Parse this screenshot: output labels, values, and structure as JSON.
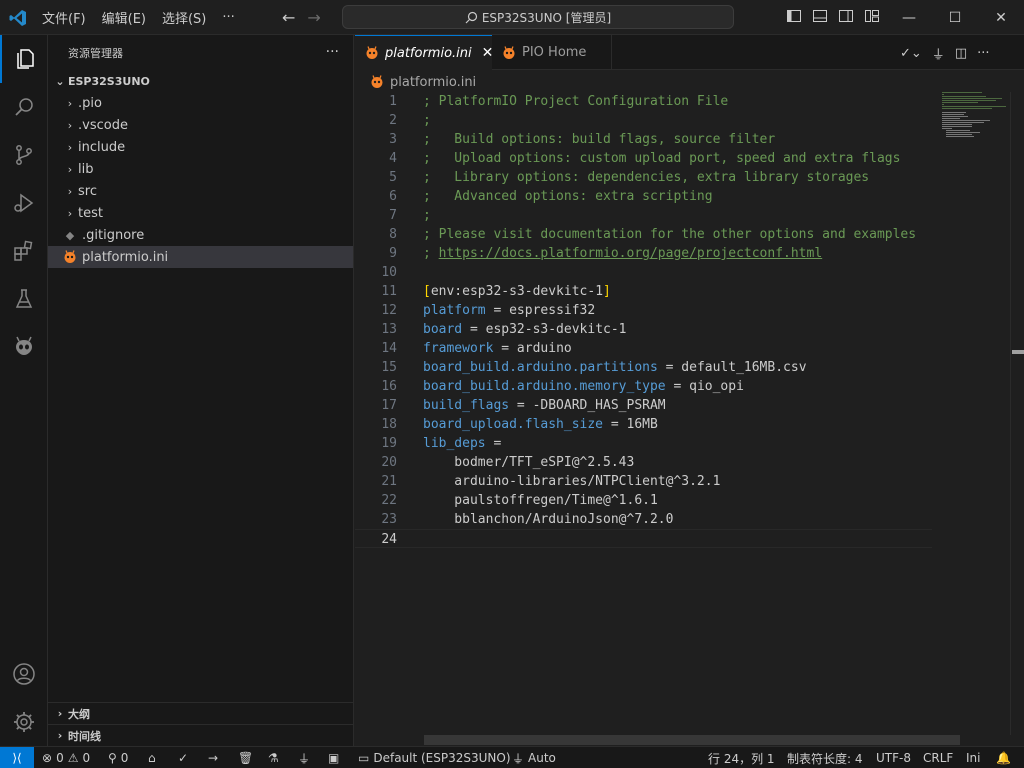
{
  "titlebar": {
    "menus": [
      "文件(F)",
      "编辑(E)",
      "选择(S)",
      "···"
    ],
    "search_text": "ESP32S3UNO [管理员]",
    "window_controls": [
      "minimize",
      "maximize",
      "close"
    ]
  },
  "sidebar": {
    "title": "资源管理器",
    "more": "···",
    "root": "ESP32S3UNO",
    "items": [
      {
        "label": ".pio",
        "type": "folder"
      },
      {
        "label": ".vscode",
        "type": "folder"
      },
      {
        "label": "include",
        "type": "folder"
      },
      {
        "label": "lib",
        "type": "folder"
      },
      {
        "label": "src",
        "type": "folder"
      },
      {
        "label": "test",
        "type": "folder"
      },
      {
        "label": ".gitignore",
        "type": "file"
      },
      {
        "label": "platformio.ini",
        "type": "file",
        "selected": true
      }
    ],
    "outline": "大纲",
    "timeline": "时间线"
  },
  "tabs": [
    {
      "label": "platformio.ini",
      "active": true
    },
    {
      "label": "PIO Home",
      "active": false
    }
  ],
  "breadcrumb": "platformio.ini",
  "editor": {
    "current_line": 24,
    "lines": [
      "; PlatformIO Project Configuration File",
      ";",
      ";   Build options: build flags, source filter",
      ";   Upload options: custom upload port, speed and extra flags",
      ";   Library options: dependencies, extra library storages",
      ";   Advanced options: extra scripting",
      ";",
      "; Please visit documentation for the other options and examples",
      "; https://docs.platformio.org/page/projectconf.html",
      "",
      "[env:esp32-s3-devkitc-1]",
      "platform = espressif32",
      "board = esp32-s3-devkitc-1",
      "framework = arduino",
      "board_build.arduino.partitions = default_16MB.csv",
      "board_build.arduino.memory_type = qio_opi",
      "build_flags = -DBOARD_HAS_PSRAM",
      "board_upload.flash_size = 16MB",
      "lib_deps =",
      "    bodmer/TFT_eSPI@^2.5.43",
      "    arduino-libraries/NTPClient@^3.2.1",
      "    paulstoffregen/Time@^1.6.1",
      "    bblanchon/ArduinoJson@^7.2.0",
      ""
    ]
  },
  "statusbar": {
    "problems_errors": "0",
    "problems_warnings": "0",
    "ports": "0",
    "env": "Default (ESP32S3UNO)",
    "auto": "Auto",
    "cursor": "行 24，列 1",
    "indent": "制表符长度: 4",
    "encoding": "UTF-8",
    "eol": "CRLF",
    "language": "Ini"
  },
  "colors": {
    "accent": "#0078d4",
    "comment": "#6a9955",
    "key": "#569cd6",
    "platformio_icon": "#f5822a"
  }
}
